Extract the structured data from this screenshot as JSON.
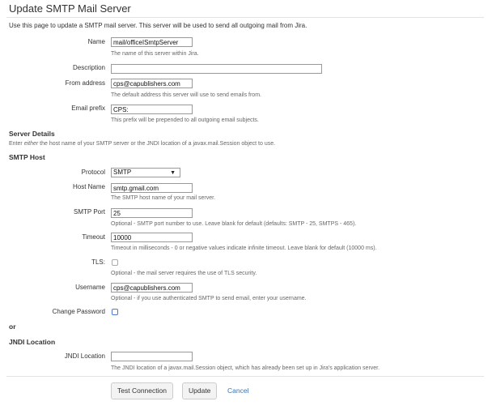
{
  "page": {
    "title": "Update SMTP Mail Server",
    "intro": "Use this page to update a SMTP mail server. This server will be used to send all outgoing mail from Jira."
  },
  "fields": {
    "name": {
      "label": "Name",
      "value": "mail/officeISmtpServer",
      "description": "The name of this server within Jira."
    },
    "description": {
      "label": "Description",
      "value": ""
    },
    "from_address": {
      "label": "From address",
      "value": "cps@capublishers.com",
      "description": "The default address this server will use to send emails from."
    },
    "email_prefix": {
      "label": "Email prefix",
      "value": "CPS:",
      "description": "This prefix will be prepended to all outgoing email subjects."
    }
  },
  "server_details": {
    "heading": "Server Details",
    "desc_prefix": "Enter ",
    "desc_emphasis": "either",
    "desc_suffix": " the host name of your SMTP server or the JNDI location of a javax.mail.Session object to use."
  },
  "smtp_host": {
    "heading": "SMTP Host",
    "protocol": {
      "label": "Protocol",
      "value": "SMTP",
      "arrow": "▼"
    },
    "host_name": {
      "label": "Host Name",
      "value": "smtp.gmail.com",
      "description": "The SMTP host name of your mail server."
    },
    "smtp_port": {
      "label": "SMTP Port",
      "value": "25",
      "description": "Optional - SMTP port number to use. Leave blank for default (defaults: SMTP - 25, SMTPS - 465)."
    },
    "timeout": {
      "label": "Timeout",
      "value": "10000",
      "description": "Timeout in milliseconds - 0 or negative values indicate infinite timeout. Leave blank for default (10000 ms)."
    },
    "tls": {
      "label": "TLS:",
      "checked": false,
      "description": "Optional - the mail server requires the use of TLS security."
    },
    "username": {
      "label": "Username",
      "value": "cps@capublishers.com",
      "description": "Optional - if you use authenticated SMTP to send email, enter your username."
    },
    "change_password": {
      "label": "Change Password",
      "checked": false
    }
  },
  "or_text": "or",
  "jndi": {
    "heading": "JNDI Location",
    "label": "JNDI Location",
    "value": "",
    "description": "The JNDI location of a javax.mail.Session object, which has already been set up in Jira's application server."
  },
  "actions": {
    "test_connection": "Test Connection",
    "update": "Update",
    "cancel": "Cancel"
  },
  "colors": {
    "link": "#3b73af",
    "checkbox_highlight": "#4a7bd0"
  }
}
